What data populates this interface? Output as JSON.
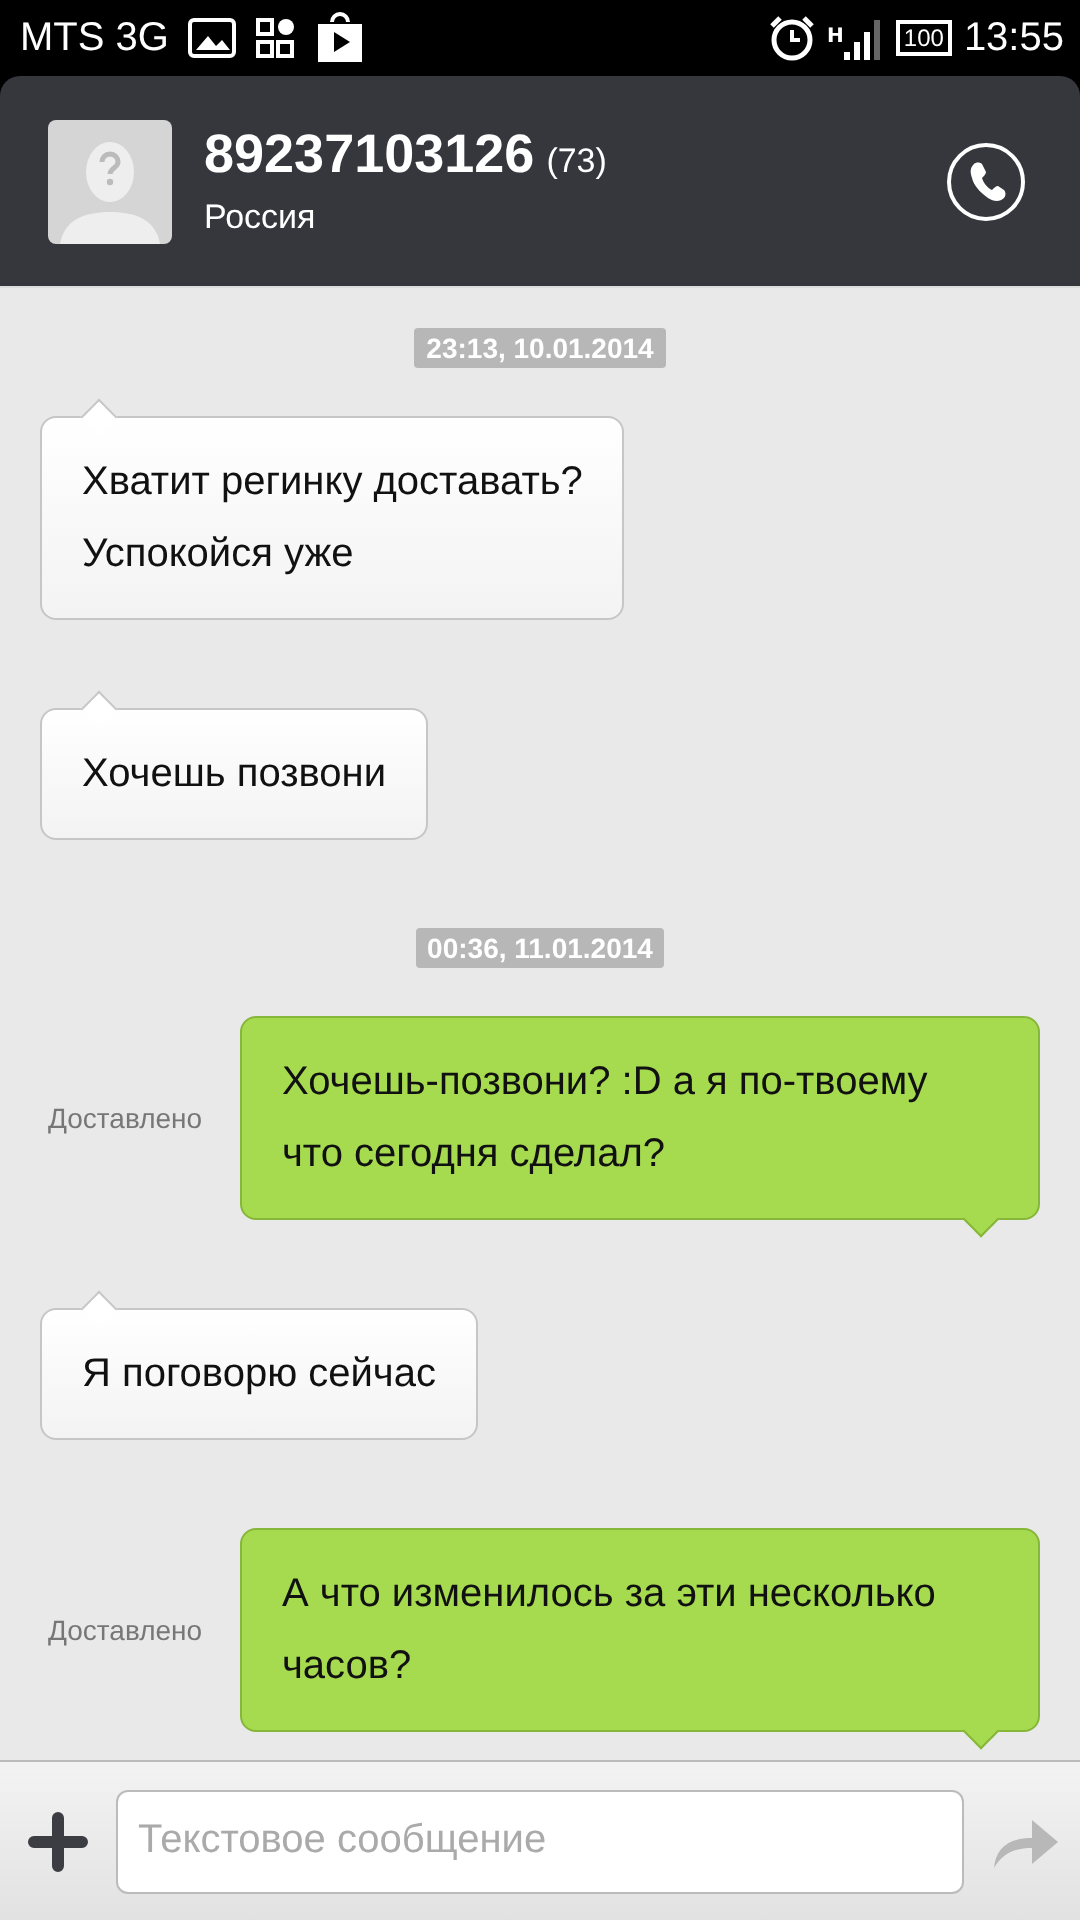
{
  "status_bar": {
    "carrier": "MTS 3G",
    "network_type": "H",
    "battery": "100",
    "time": "13:55"
  },
  "contact": {
    "number": "89237103126",
    "count": "(73)",
    "region": "Россия"
  },
  "messages": [
    {
      "kind": "date",
      "text": "23:13, 10.01.2014"
    },
    {
      "kind": "in",
      "text": "Хватит регинку доставать?\nУспокойся уже"
    },
    {
      "kind": "in",
      "text": "Хочешь позвони"
    },
    {
      "kind": "date",
      "text": "00:36, 11.01.2014"
    },
    {
      "kind": "out",
      "text": "Хочешь-позвони? :D а я по-твоему что сегодня сделал?",
      "status": "Доставлено"
    },
    {
      "kind": "in",
      "text": "Я поговорю сейчас"
    },
    {
      "kind": "out",
      "text": "А что изменилось за эти несколько часов?",
      "status": "Доставлено"
    }
  ],
  "composer": {
    "placeholder": "Текстовое сообщение"
  }
}
